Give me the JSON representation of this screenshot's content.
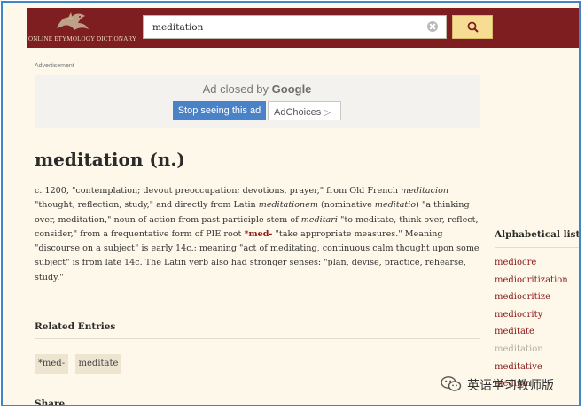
{
  "header": {
    "logo_text": "ONLINE ETYMOLOGY DICTIONARY",
    "background_color": "#7e1e21"
  },
  "search": {
    "value": "meditation",
    "clear_icon": "clear-circle-icon",
    "button_icon": "magnifier-icon",
    "button_color": "#f7dc94"
  },
  "ad": {
    "label": "Advertisement",
    "closed_prefix": "Ad closed by",
    "closed_brand": "Google",
    "stop_button": "Stop seeing this ad",
    "adchoices": "AdChoices",
    "adchoices_icon": "▷"
  },
  "entry": {
    "title": "meditation (n.)",
    "body": [
      {
        "t": "c. 1200, \"contemplation; devout preoccupation; devotions, prayer,\" from Old French "
      },
      {
        "i": "meditacion"
      },
      {
        "t": " \"thought, reflection, study,\" and directly from Latin "
      },
      {
        "i": "meditationem"
      },
      {
        "t": " (nominative "
      },
      {
        "i": "meditatio"
      },
      {
        "t": ") \"a thinking over, meditation,\" noun of action from past participle stem of "
      },
      {
        "i": "meditari"
      },
      {
        "t": " \"to meditate, think over, reflect, consider,\" from a frequentative form of PIE root "
      },
      {
        "b": "*med-"
      },
      {
        "t": " \"take appropriate measures.\" Meaning \"discourse on a subject\" is early 14c.; meaning \"act of meditating, continuous calm thought upon some subject\" is from late 14c. The Latin verb also had stronger senses: \"plan, devise, practice, rehearse, study.\""
      }
    ]
  },
  "related": {
    "title": "Related Entries",
    "tags": [
      "*med-",
      "meditate"
    ]
  },
  "share": {
    "title": "Share"
  },
  "alphabetical": {
    "title": "Alphabetical list",
    "items": [
      "mediocre",
      "mediocritization",
      "mediocritize",
      "mediocrity",
      "meditate",
      "meditation",
      "meditative",
      "medium"
    ],
    "current": "meditation",
    "link_color": "#8b1a1a"
  },
  "watermark": {
    "text": "英语学习教师版",
    "icon": "wechat-icon"
  }
}
